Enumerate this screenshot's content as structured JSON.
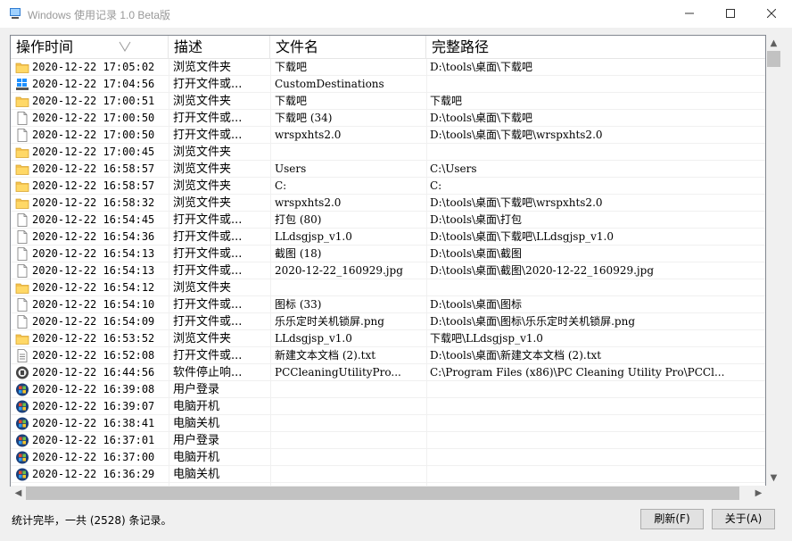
{
  "window": {
    "title": "Windows 使用记录 1.0 Beta版"
  },
  "columns": [
    "操作时间",
    "描述",
    "文件名",
    "完整路径"
  ],
  "rows": [
    {
      "icon": "folder-icon",
      "time": "2020-12-22 17:05:02",
      "desc": "浏览文件夹",
      "file": "下载吧",
      "path": "D:\\tools\\桌面\\下载吧"
    },
    {
      "icon": "windows-drive-icon",
      "time": "2020-12-22 17:04:56",
      "desc": "打开文件或...",
      "file": "CustomDestinations",
      "path": ""
    },
    {
      "icon": "folder-icon",
      "time": "2020-12-22 17:00:51",
      "desc": "浏览文件夹",
      "file": "下载吧",
      "path": "下载吧"
    },
    {
      "icon": "file-icon",
      "time": "2020-12-22 17:00:50",
      "desc": "打开文件或...",
      "file": "下载吧 (34)",
      "path": "D:\\tools\\桌面\\下载吧"
    },
    {
      "icon": "file-icon",
      "time": "2020-12-22 17:00:50",
      "desc": "打开文件或...",
      "file": "wrspxhts2.0",
      "path": "D:\\tools\\桌面\\下载吧\\wrspxhts2.0"
    },
    {
      "icon": "folder-icon",
      "time": "2020-12-22 17:00:45",
      "desc": "浏览文件夹",
      "file": "",
      "path": ""
    },
    {
      "icon": "folder-icon",
      "time": "2020-12-22 16:58:57",
      "desc": "浏览文件夹",
      "file": "Users",
      "path": "C:\\Users"
    },
    {
      "icon": "folder-icon",
      "time": "2020-12-22 16:58:57",
      "desc": "浏览文件夹",
      "file": "C:",
      "path": "C:"
    },
    {
      "icon": "folder-icon",
      "time": "2020-12-22 16:58:32",
      "desc": "浏览文件夹",
      "file": "wrspxhts2.0",
      "path": "D:\\tools\\桌面\\下载吧\\wrspxhts2.0"
    },
    {
      "icon": "file-icon",
      "time": "2020-12-22 16:54:45",
      "desc": "打开文件或...",
      "file": "打包 (80)",
      "path": "D:\\tools\\桌面\\打包"
    },
    {
      "icon": "file-icon",
      "time": "2020-12-22 16:54:36",
      "desc": "打开文件或...",
      "file": "LLdsgjsp_v1.0",
      "path": "D:\\tools\\桌面\\下载吧\\LLdsgjsp_v1.0"
    },
    {
      "icon": "file-icon",
      "time": "2020-12-22 16:54:13",
      "desc": "打开文件或...",
      "file": "截图 (18)",
      "path": "D:\\tools\\桌面\\截图"
    },
    {
      "icon": "file-icon",
      "time": "2020-12-22 16:54:13",
      "desc": "打开文件或...",
      "file": "2020-12-22_160929.jpg",
      "path": "D:\\tools\\桌面\\截图\\2020-12-22_160929.jpg"
    },
    {
      "icon": "folder-icon",
      "time": "2020-12-22 16:54:12",
      "desc": "浏览文件夹",
      "file": "",
      "path": ""
    },
    {
      "icon": "file-icon",
      "time": "2020-12-22 16:54:10",
      "desc": "打开文件或...",
      "file": "图标 (33)",
      "path": "D:\\tools\\桌面\\图标"
    },
    {
      "icon": "file-icon",
      "time": "2020-12-22 16:54:09",
      "desc": "打开文件或...",
      "file": "乐乐定时关机锁屏.png",
      "path": "D:\\tools\\桌面\\图标\\乐乐定时关机锁屏.png"
    },
    {
      "icon": "folder-icon",
      "time": "2020-12-22 16:53:52",
      "desc": "浏览文件夹",
      "file": "LLdsgjsp_v1.0",
      "path": "下载吧\\LLdsgjsp_v1.0"
    },
    {
      "icon": "text-file-icon",
      "time": "2020-12-22 16:52:08",
      "desc": "打开文件或...",
      "file": "新建文本文档 (2).txt",
      "path": "D:\\tools\\桌面\\新建文本文档 (2).txt"
    },
    {
      "icon": "app-stop-icon",
      "time": "2020-12-22 16:44:56",
      "desc": "软件停止响...",
      "file": "PCCleaningUtilityPro...",
      "path": "C:\\Program Files (x86)\\PC Cleaning Utility Pro\\PCCl..."
    },
    {
      "icon": "windows-orb-icon",
      "time": "2020-12-22 16:39:08",
      "desc": "用户登录",
      "file": "",
      "path": ""
    },
    {
      "icon": "windows-orb-icon",
      "time": "2020-12-22 16:39:07",
      "desc": "电脑开机",
      "file": "",
      "path": ""
    },
    {
      "icon": "windows-orb-icon",
      "time": "2020-12-22 16:38:41",
      "desc": "电脑关机",
      "file": "",
      "path": ""
    },
    {
      "icon": "windows-orb-icon",
      "time": "2020-12-22 16:37:01",
      "desc": "用户登录",
      "file": "",
      "path": ""
    },
    {
      "icon": "windows-orb-icon",
      "time": "2020-12-22 16:37:00",
      "desc": "电脑开机",
      "file": "",
      "path": ""
    },
    {
      "icon": "windows-orb-icon",
      "time": "2020-12-22 16:36:29",
      "desc": "电脑关机",
      "file": "",
      "path": ""
    }
  ],
  "status": "统计完毕，一共 (2528) 条记录。",
  "buttons": {
    "refresh": "刷新(F)",
    "about": "关于(A)"
  },
  "colors": {
    "folder": "#f4c24f",
    "border": "#828790",
    "button_bg": "#e1e1e1"
  }
}
